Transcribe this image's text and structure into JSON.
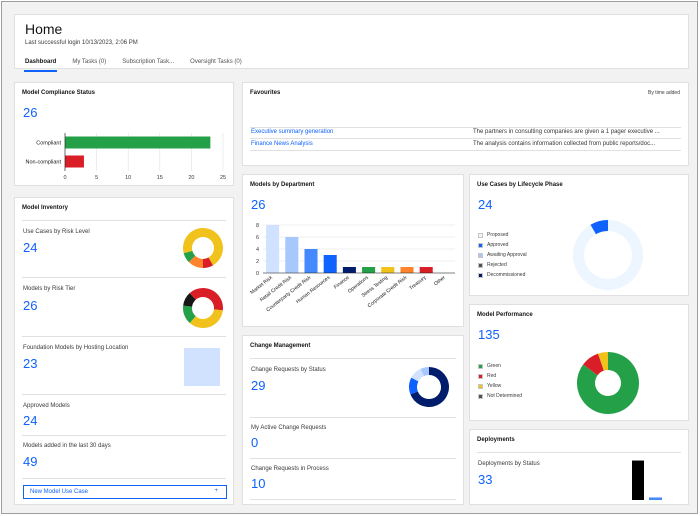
{
  "header": {
    "title": "Home",
    "last_login": "Last successful login 10/13/2023, 2:06 PM",
    "tabs": [
      "Dashboard",
      "My Tasks (0)",
      "Subscription Task...",
      "Oversight Tasks (0)"
    ]
  },
  "compliance": {
    "title": "Model Compliance Status",
    "count": "26",
    "chart_data": {
      "type": "bar",
      "orientation": "horizontal",
      "categories": [
        "Compliant",
        "Non-compliant"
      ],
      "values": [
        23,
        3
      ],
      "colors": [
        "#24a148",
        "#da1e28"
      ],
      "xlim": [
        0,
        25
      ],
      "xticks": [
        "0",
        "5",
        "10",
        "15",
        "20",
        "25"
      ]
    }
  },
  "favourites": {
    "title": "Favourites",
    "sort_label": "By time added",
    "items": [
      {
        "name": "Executive summary generation",
        "desc": "The partners in consulting companies are given a 1 pager executive ..."
      },
      {
        "name": "Finance News Analysis",
        "desc": "The analysis contains information collected from public reports/doc..."
      }
    ]
  },
  "inventory": {
    "title": "Model Inventory",
    "rows": [
      {
        "label": "Use Cases by Risk Level",
        "value": "24"
      },
      {
        "label": "Models by Risk Tier",
        "value": "26"
      },
      {
        "label": "Foundation Models by Hosting Location",
        "value": "23"
      },
      {
        "label": "Approved Models",
        "value": "24"
      },
      {
        "label": "Models added in the last 30 days",
        "value": "49"
      }
    ],
    "new_button": "New Model Use Case",
    "new_button_icon": "+",
    "risk_level_donut": [
      {
        "value": 10,
        "color": "#f1c21b"
      },
      {
        "value": 2,
        "color": "#da1e28"
      },
      {
        "value": 3,
        "color": "#ff832b"
      },
      {
        "value": 2,
        "color": "#24a148"
      },
      {
        "value": 7,
        "color": "#f1c21b"
      }
    ],
    "risk_tier_donut": [
      {
        "value": 7,
        "color": "#da1e28"
      },
      {
        "value": 9,
        "color": "#f1c21b"
      },
      {
        "value": 4,
        "color": "#24a148"
      },
      {
        "value": 3,
        "color": "#161616"
      },
      {
        "value": 3,
        "color": "#da1e28"
      }
    ]
  },
  "department": {
    "title": "Models by Department",
    "count": "26",
    "chart_data": {
      "type": "bar",
      "categories": [
        "Market Risk",
        "Retail Credit Risk",
        "Counterparty Credit Risk",
        "Human Resources",
        "Finance",
        "Operations",
        "Stress Testing",
        "Corporate Credit Risk",
        "Treasury",
        "Other"
      ],
      "values": [
        8,
        6,
        4,
        3,
        1,
        1,
        1,
        1,
        1,
        0
      ],
      "colors": [
        "#d0e2ff",
        "#a6c8ff",
        "#4589ff",
        "#0f62fe",
        "#001d6c",
        "#24a148",
        "#f1c21b",
        "#ff832b",
        "#da1e28",
        "#8d8d8d"
      ],
      "ylim": [
        0,
        8
      ],
      "yticks": [
        "0",
        "2",
        "4",
        "6",
        "8"
      ]
    }
  },
  "lifecycle": {
    "title": "Use Cases by Lifecycle Phase",
    "count": "24",
    "legend": [
      {
        "label": "Proposed",
        "color": "#edf5ff"
      },
      {
        "label": "Approved",
        "color": "#0f62fe"
      },
      {
        "label": "Awaiting Approval",
        "color": "#a6c8ff"
      },
      {
        "label": "Rejected",
        "color": "#525252"
      },
      {
        "label": "Decommissioned",
        "color": "#001d6c"
      }
    ],
    "donut": [
      {
        "value": 22,
        "color": "#edf5ff"
      },
      {
        "value": 2,
        "color": "#0f62fe"
      }
    ]
  },
  "performance": {
    "title": "Model Performance",
    "count": "135",
    "legend": [
      {
        "label": "Green",
        "color": "#24a148"
      },
      {
        "label": "Red",
        "color": "#da1e28"
      },
      {
        "label": "Yellow",
        "color": "#f1c21b"
      },
      {
        "label": "Not Determined",
        "color": "#525252"
      }
    ],
    "donut": [
      {
        "value": 115,
        "color": "#24a148"
      },
      {
        "value": 13,
        "color": "#da1e28"
      },
      {
        "value": 7,
        "color": "#f1c21b"
      }
    ]
  },
  "change": {
    "title": "Change Management",
    "rows": [
      {
        "label": "Change Requests by Status",
        "value": "29"
      },
      {
        "label": "My Active Change Requests",
        "value": "0"
      },
      {
        "label": "Change Requests in Process",
        "value": "10"
      }
    ],
    "donut": [
      {
        "value": 20,
        "color": "#001d6c"
      },
      {
        "value": 4,
        "color": "#0f62fe"
      },
      {
        "value": 3,
        "color": "#d0e2ff"
      },
      {
        "value": 2,
        "color": "#a6c8ff"
      }
    ]
  },
  "deployments": {
    "title": "Deployments",
    "rows": [
      {
        "label": "Deployments by Status",
        "value": "33"
      }
    ],
    "chart_data": {
      "type": "bar",
      "categories": [
        "",
        ""
      ],
      "values": [
        31,
        2
      ],
      "colors": [
        "#000000",
        "#4589ff"
      ],
      "ylim": [
        0,
        33
      ]
    }
  }
}
